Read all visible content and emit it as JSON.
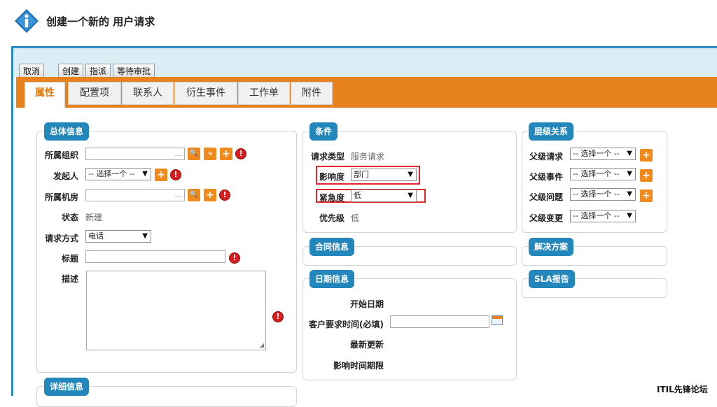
{
  "page": {
    "title": "创建一个新的 用户请求"
  },
  "toolbar": {
    "cancel": "取消",
    "create": "创建",
    "assign": "指派",
    "await_approval": "等待审批"
  },
  "tabs": [
    "属性",
    "配置项",
    "联系人",
    "衍生事件",
    "工作单",
    "附件"
  ],
  "general": {
    "title": "总体信息",
    "org_label": "所属组织",
    "org_value": "...",
    "initiator_label": "发起人",
    "initiator_value": "-- 选择一个 --",
    "room_label": "所属机房",
    "room_value": "...",
    "status_label": "状态",
    "status_value": "新建",
    "method_label": "请求方式",
    "method_value": "电话",
    "subject_label": "标题",
    "desc_label": "描述"
  },
  "detail": {
    "title": "详细信息"
  },
  "conditions": {
    "title": "条件",
    "type_label": "请求类型",
    "type_value": "服务请求",
    "impact_label": "影响度",
    "impact_value": "部门",
    "urgency_label": "紧急度",
    "urgency_value": "低",
    "priority_label": "优先级",
    "priority_value": "低"
  },
  "contract": {
    "title": "合同信息"
  },
  "dates": {
    "title": "日期信息",
    "start_label": "开始日期",
    "customer_req_label": "客户要求时间(必填)",
    "last_update_label": "最新更新",
    "impact_deadline_label": "影响时间期限"
  },
  "hierarchy": {
    "title": "层级关系",
    "parent_request_label": "父级请求",
    "parent_event_label": "父级事件",
    "parent_problem_label": "父级问题",
    "parent_change_label": "父级变更",
    "select_placeholder": "-- 选择一个 --"
  },
  "solution": {
    "title": "解决方案"
  },
  "sla": {
    "title": "SLA报告"
  },
  "watermark": "ITIL先锋论坛",
  "colors": {
    "accent_orange": "#e8821e",
    "title_blue": "#2387bb",
    "required_red": "#d81e1e",
    "highlight_red": "#e3242b"
  },
  "icons": {
    "info": "info-icon",
    "search": "search-icon",
    "tree": "tree-icon",
    "add": "plus-icon",
    "required": "exclamation-icon",
    "calendar": "calendar-icon"
  }
}
